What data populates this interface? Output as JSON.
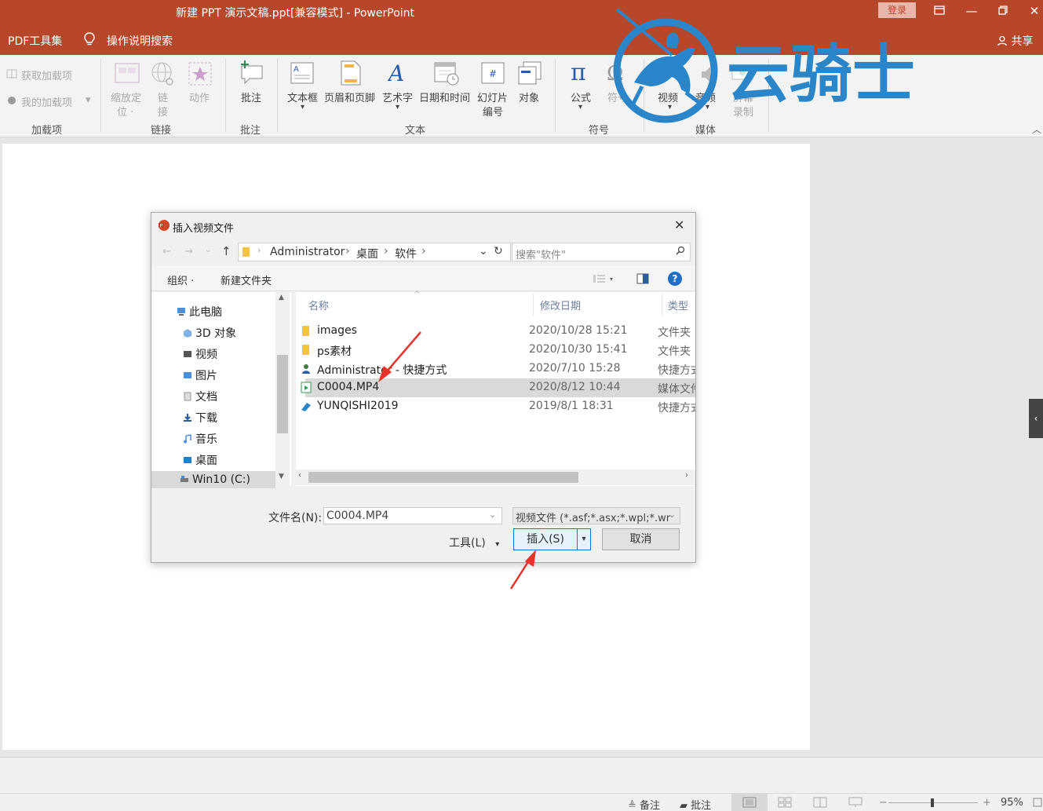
{
  "window": {
    "title": "新建 PPT 演示文稿.ppt[兼容模式] - PowerPoint",
    "login": "登录",
    "share": "共享"
  },
  "tabs": {
    "pdf": "PDF工具集",
    "tell_me": "操作说明搜索"
  },
  "ribbon": {
    "addins": {
      "get": "获取加载项",
      "mine": "我的加载项",
      "group": "加载项"
    },
    "links": {
      "zoom": "缩放定",
      "zoom2": "位 ·",
      "link": "链",
      "link2": "接",
      "action": "动作",
      "group": "链接"
    },
    "comments": {
      "comment": "批注",
      "group": "批注"
    },
    "text": {
      "textbox": "文本框",
      "header_footer": "页眉和页脚",
      "wordart": "艺术字",
      "datetime": "日期和时间",
      "slide_number": "幻灯片",
      "slide_number2": "编号",
      "object": "对象",
      "group": "文本"
    },
    "symbols": {
      "equation": "公式",
      "symbol": "符号",
      "group": "符号"
    },
    "media": {
      "video": "视频",
      "audio": "音频",
      "record": "屏幕",
      "record2": "录制",
      "group": "媒体"
    }
  },
  "watermark": {
    "text": "云骑士"
  },
  "dialog": {
    "title": "插入视频文件",
    "path": [
      "Administrator",
      "桌面",
      "软件"
    ],
    "search_placeholder": "搜索\"软件\"",
    "organize": "组织 ·",
    "new_folder": "新建文件夹",
    "help": "?",
    "nav_items": [
      {
        "label": "此电脑"
      },
      {
        "label": "3D 对象"
      },
      {
        "label": "视频"
      },
      {
        "label": "图片"
      },
      {
        "label": "文档"
      },
      {
        "label": "下载"
      },
      {
        "label": "音乐"
      },
      {
        "label": "桌面"
      },
      {
        "label": "Win10 (C:)"
      }
    ],
    "columns": {
      "name": "名称",
      "modified": "修改日期",
      "type": "类型"
    },
    "files": [
      {
        "name": "images",
        "modified": "2020/10/28 15:21",
        "type": "文件夹"
      },
      {
        "name": "ps素材",
        "modified": "2020/10/30 15:41",
        "type": "文件夹"
      },
      {
        "name": "Administrator - 快捷方式",
        "modified": "2020/7/10 15:28",
        "type": "快捷方式"
      },
      {
        "name": "C0004.MP4",
        "modified": "2020/8/12 10:44",
        "type": "媒体文件"
      },
      {
        "name": "YUNQISHI2019",
        "modified": "2019/8/1 18:31",
        "type": "快捷方式"
      }
    ],
    "filename_label": "文件名(N):",
    "filename_value": "C0004.MP4",
    "filetype_value": "视频文件 (*.asf;*.asx;*.wpl;*.wr",
    "tools": "工具(L)",
    "insert": "插入(S)",
    "cancel": "取消"
  },
  "status": {
    "notes": "备注",
    "comments": "批注",
    "zoom": "95%"
  },
  "colors": {
    "accent": "#b7472a",
    "annotation": "#e8322b"
  }
}
